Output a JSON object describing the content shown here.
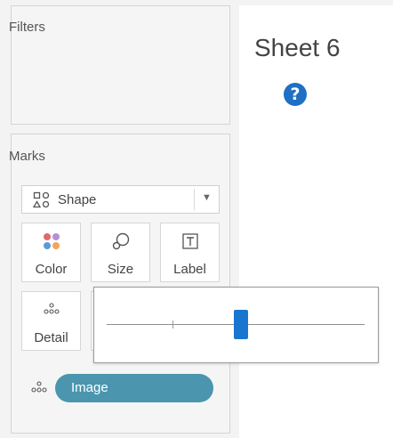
{
  "filters": {
    "title": "Filters"
  },
  "marks": {
    "title": "Marks",
    "mark_type": {
      "label": "Shape",
      "icon": "shape-icon",
      "dropdown_icon": "chevron-down-icon"
    },
    "buttons": [
      {
        "label": "Color",
        "icon": "color-dots-icon"
      },
      {
        "label": "Size",
        "icon": "size-icon"
      },
      {
        "label": "Label",
        "icon": "text-label-icon"
      },
      {
        "label": "Detail",
        "icon": "detail-dots-icon"
      }
    ],
    "pill": {
      "label": "Image",
      "icon": "detail-dots-icon",
      "color": "#4b96ae"
    }
  },
  "sheet": {
    "title": "Sheet 6",
    "help_icon": "help-question-icon",
    "help_glyph": "?"
  },
  "size_slider": {
    "level": 0.52,
    "handle_color": "#1876d1"
  }
}
